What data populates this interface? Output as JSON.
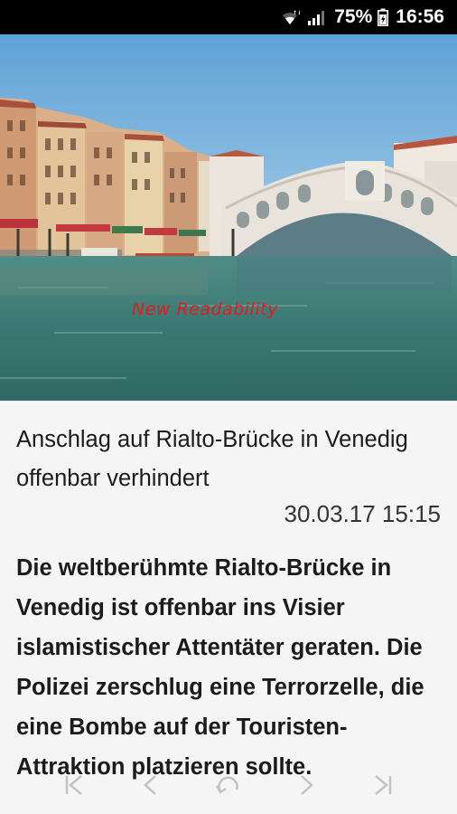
{
  "status_bar": {
    "battery_percent": "75%",
    "time": "16:56",
    "icons": [
      "wifi-icon",
      "signal-icon",
      "battery-icon"
    ]
  },
  "hero": {
    "watermark": "New Readability"
  },
  "article": {
    "headline": "Anschlag auf Rialto-Brücke in Venedig offenbar verhindert",
    "date": "30.03.17 15:15",
    "lead": "Die weltberühmte Rialto-Brücke in Venedig ist offenbar ins Visier islamistischer Attentäter geraten. Die Polizei zerschlug eine Terrorzelle, die eine Bombe auf der Touristen-Attraktion platzieren sollte."
  },
  "bottom_nav": {
    "icons": [
      "first-page-icon",
      "previous-icon",
      "reload-icon",
      "next-icon",
      "last-page-icon"
    ]
  },
  "colors": {
    "status_bar_bg": "#000000",
    "page_bg": "#f5f5f5",
    "text": "#1b1b1b",
    "watermark": "#e21b1b"
  }
}
